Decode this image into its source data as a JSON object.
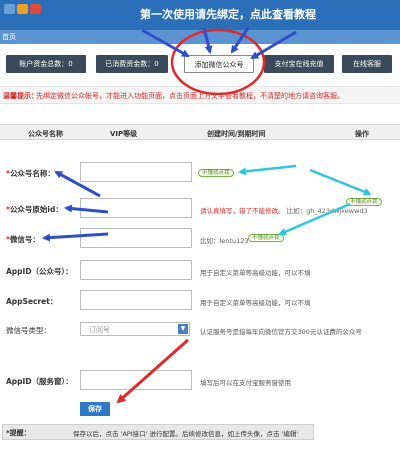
{
  "banner": {
    "title": "第一次使用请先绑定，点此查看教程"
  },
  "tabs": [
    {
      "label": "首页"
    }
  ],
  "actions": [
    {
      "label": "账户资金总数：0"
    },
    {
      "label": "已消费资金数：0"
    },
    {
      "label": "添加微信公众号"
    },
    {
      "label": "支付宝在线充值"
    },
    {
      "label": "在线客服"
    }
  ],
  "notice": {
    "label": "温馨提示：",
    "text": "先绑定微信公众帐号，才能进入功能页面，点击页面上方文字查看教程，不清楚的地方请咨询客服。"
  },
  "table": {
    "columns": [
      "公众号名称",
      "VIP等级",
      "创建时间/到期时间",
      "操作"
    ]
  },
  "form": {
    "name": {
      "label": "公众号名称：",
      "badge": "不懂就点我"
    },
    "origin_id": {
      "label": "公众号原始id：",
      "hint": "请认真填写，错了不能修改。",
      "example": "比如：gh_423dwjkewwd3",
      "badge": "不懂就点我"
    },
    "wechat_id": {
      "label": "微信号：",
      "hint": "比如：lentu123",
      "badge": "不懂就点我"
    },
    "appid": {
      "label": "AppID（公众号）：",
      "hint": "用于自定义菜单等高级功能，可以不填"
    },
    "appsecret": {
      "label": "AppSecret：",
      "hint": "用于自定义菜单等高级功能，可以不填"
    },
    "account_type": {
      "label": "微信号类型：",
      "value": "订阅号",
      "hint": "认证服务号是指每年向微信官方交300元认证费的公众号"
    },
    "appid_service": {
      "label": "AppID（服务窗）：",
      "hint": "填写后可以在支付宝服务窗使用"
    }
  },
  "save_button": {
    "label": "保存"
  },
  "tip": {
    "label": "*提醒：",
    "text": "保存以后，点击 'API接口' 进行配置。后续修改信息，如上传头像，点击 '编辑'"
  },
  "colors": {
    "topbar": "#2a6fb8",
    "annotation_blue": "#2f4fc8",
    "annotation_cyan": "#2ec8d8",
    "annotation_red": "#e02a2a",
    "save_button": "#2f78c5"
  }
}
